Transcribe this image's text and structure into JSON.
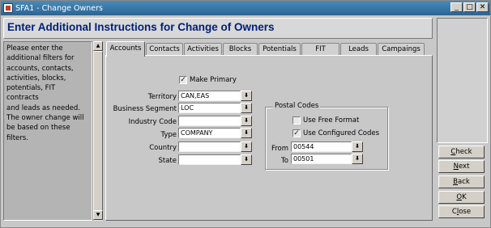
{
  "window": {
    "title": "SFA1 - Change Owners",
    "minimize_glyph": "_",
    "maximize_glyph": "□",
    "close_glyph": "✕"
  },
  "header": {
    "title": "Enter Additional Instructions for Change of Owners"
  },
  "instructions": {
    "lines": [
      "Please enter the",
      "additional filters for",
      "accounts, contacts,",
      "activities, blocks,",
      "potentials, FIT contracts",
      "and leads as needed.",
      "The owner change will",
      "be based on these filters."
    ]
  },
  "tabs": [
    {
      "label": "Accounts",
      "active": true
    },
    {
      "label": "Contacts",
      "active": false
    },
    {
      "label": "Activities",
      "active": false
    },
    {
      "label": "Blocks",
      "active": false
    },
    {
      "label": "Potentials",
      "active": false
    },
    {
      "label": "FIT",
      "active": false
    },
    {
      "label": "Leads",
      "active": false
    },
    {
      "label": "Campaings",
      "active": false
    }
  ],
  "form": {
    "make_primary": {
      "label": "Make Primary",
      "checked": true
    },
    "fields": [
      {
        "label": "Territory",
        "value": "CAN,EAS"
      },
      {
        "label": "Business Segment",
        "value": "LOC"
      },
      {
        "label": "Industry Code",
        "value": ""
      },
      {
        "label": "Type",
        "value": "COMPANY"
      },
      {
        "label": "Country",
        "value": ""
      },
      {
        "label": "State",
        "value": ""
      }
    ],
    "lov_glyph": "⬇"
  },
  "postal_codes": {
    "legend": "Postal Codes",
    "use_free_format": {
      "label": "Use Free Format",
      "checked": false
    },
    "use_configured_codes": {
      "label": "Use Configured Codes",
      "checked": true
    },
    "from": {
      "label": "From",
      "value": "00544"
    },
    "to": {
      "label": "To",
      "value": "00501"
    }
  },
  "buttons": [
    {
      "label": "Check",
      "key": "C"
    },
    {
      "label": "Next",
      "key": "N"
    },
    {
      "label": "Back",
      "key": "B"
    },
    {
      "label": "OK",
      "key": "O"
    },
    {
      "label": "Close",
      "key": "l"
    }
  ],
  "colors": {
    "title_bar": "#2a6496",
    "header_text": "#00207a"
  }
}
